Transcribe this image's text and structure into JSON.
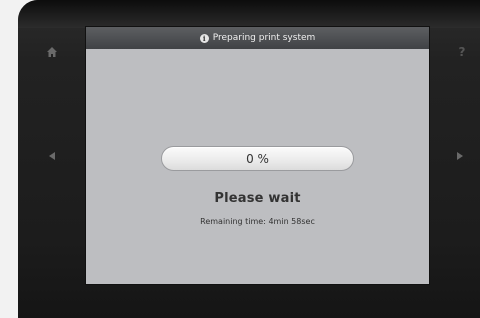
{
  "window": {
    "title": "Preparing print system"
  },
  "progress": {
    "value": 0,
    "label": "0 %"
  },
  "status": {
    "message": "Please wait",
    "remaining": "Remaining time: 4min 58sec"
  },
  "side_buttons": {
    "home": "home-icon",
    "help": "?",
    "left": "arrow-left-icon",
    "right": "arrow-right-icon"
  },
  "colors": {
    "screen_bg": "#bdbec1",
    "titlebar": "#4d4f52",
    "bezel": "#1e1e1e"
  }
}
